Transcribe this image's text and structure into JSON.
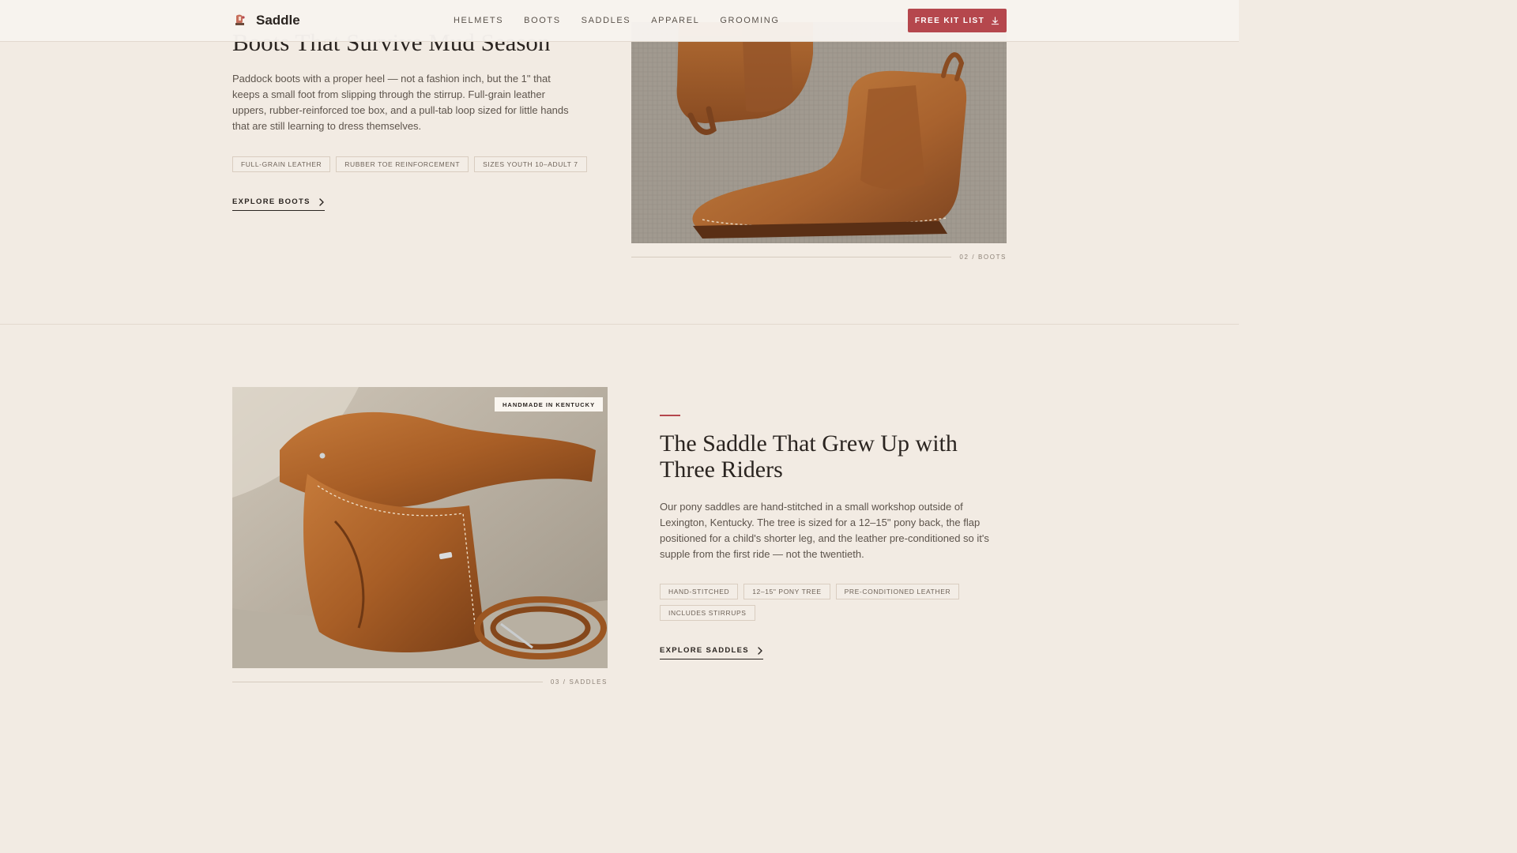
{
  "header": {
    "brand": "Saddle",
    "nav": [
      "HELMETS",
      "BOOTS",
      "SADDLES",
      "APPAREL",
      "GROOMING"
    ],
    "cta_label": "FREE KIT LIST"
  },
  "boots_section": {
    "title": "Boots That Survive Mud Season",
    "body": "Paddock boots with a proper heel — not a fashion inch, but the 1\" that keeps a small foot from slipping through the stirrup. Full-grain leather uppers, rubber-reinforced toe box, and a pull-tab loop sized for little hands that are still learning to dress themselves.",
    "tags": [
      "FULL-GRAIN LEATHER",
      "RUBBER TOE REINFORCEMENT",
      "SIZES YOUTH 10–ADULT 7"
    ],
    "explore_label": "EXPLORE BOOTS",
    "caption": "02 / BOOTS"
  },
  "saddle_section": {
    "badge": "HANDMADE IN KENTUCKY",
    "title": "The Saddle That Grew Up with Three Riders",
    "body": "Our pony saddles are hand-stitched in a small workshop outside of Lexington, Kentucky. The tree is sized for a 12–15\" pony back, the flap positioned for a child's shorter leg, and the leather pre-conditioned so it's supple from the first ride — not the twentieth.",
    "tags": [
      "HAND-STITCHED",
      "12–15\" PONY TREE",
      "PRE-CONDITIONED LEATHER",
      "INCLUDES STIRRUPS"
    ],
    "explore_label": "EXPLORE SADDLES",
    "caption": "03 / SADDLES"
  },
  "colors": {
    "accent": "#b5474d",
    "background": "#f2ebe3",
    "text": "#2a2420",
    "leather": "#a8622e"
  },
  "icons": [
    "saddle-logo-icon",
    "download-icon",
    "chevron-right-icon"
  ]
}
